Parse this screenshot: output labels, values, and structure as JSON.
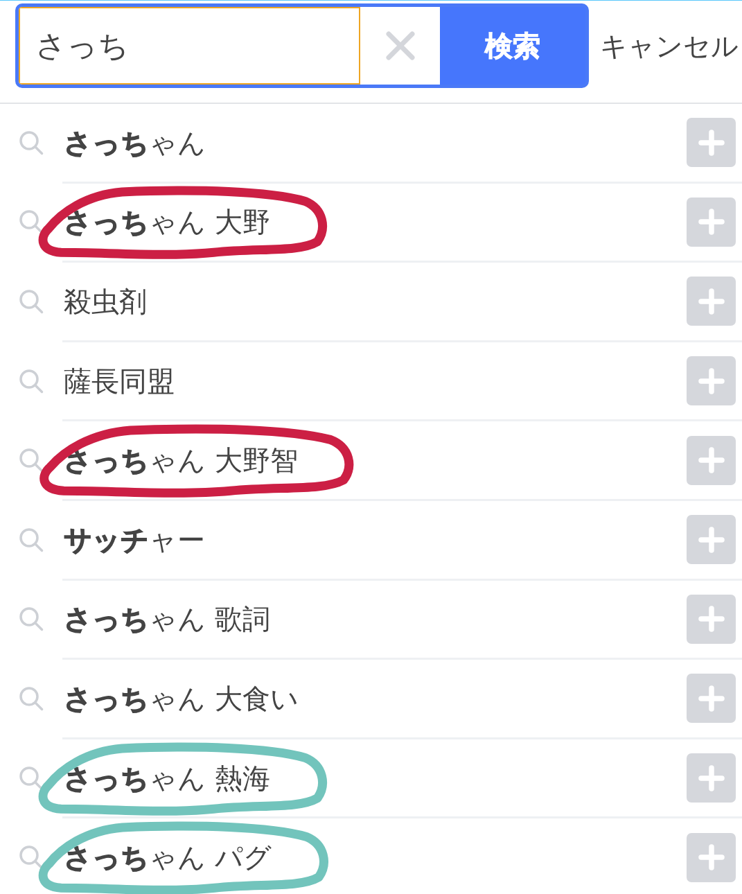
{
  "search": {
    "value": "さっち",
    "button": "検索",
    "cancel": "キャンセル"
  },
  "suggestions": [
    {
      "text": "**さっち**ゃん"
    },
    {
      "text": "**さっち**ゃん 大野",
      "color": "#cc1f44"
    },
    {
      "text": "殺虫剤"
    },
    {
      "text": "薩長同盟"
    },
    {
      "text": "**さっち**ゃん 大野智",
      "color": "#cc1f44"
    },
    {
      "text": "**サッチ**ャー"
    },
    {
      "text": "**さっち**ゃん 歌詞"
    },
    {
      "text": "**さっち**ゃん 大食い"
    },
    {
      "text": "**さっち**ゃん 熱海",
      "color": "#72c4bc"
    },
    {
      "text": "**さっち**ゃん パグ",
      "color": "#72c4bc"
    }
  ]
}
